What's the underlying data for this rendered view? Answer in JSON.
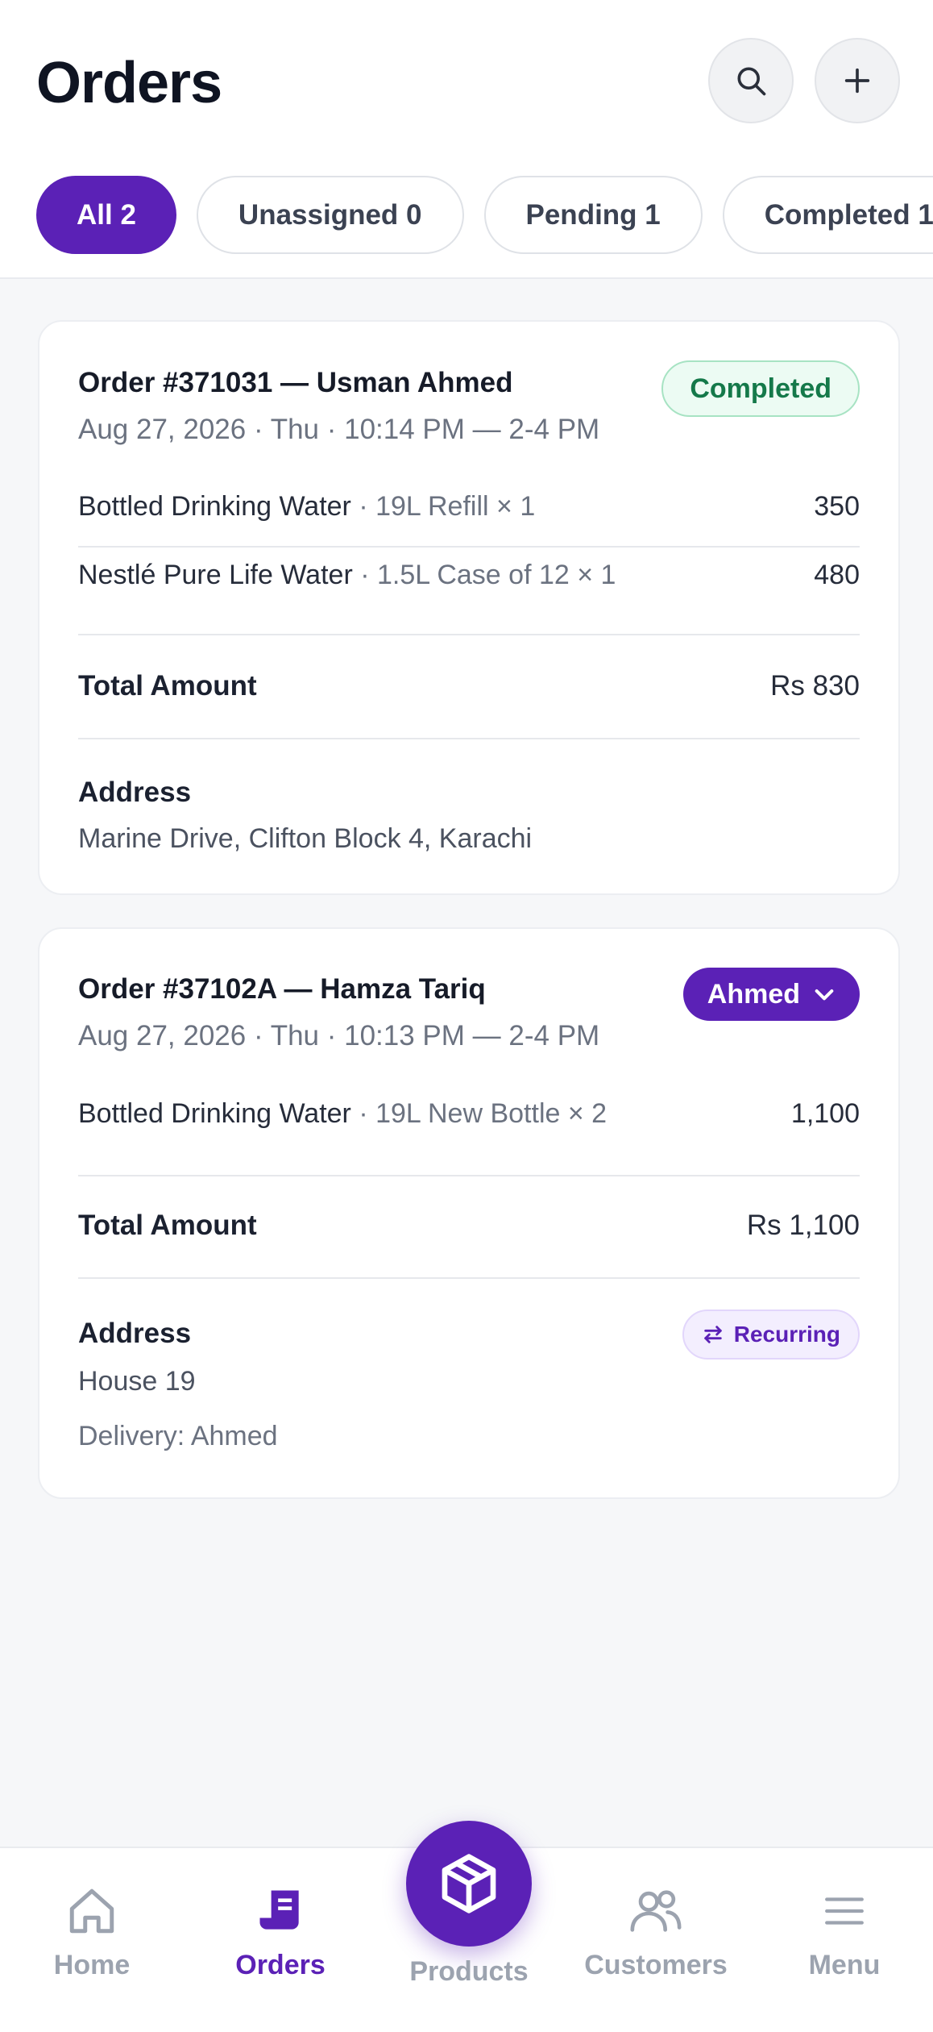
{
  "header": {
    "title": "Orders",
    "search_icon": "search-icon",
    "add_icon": "plus-icon"
  },
  "tabs": [
    {
      "label": "All 2",
      "active": true
    },
    {
      "label": "Unassigned 0",
      "active": false
    },
    {
      "label": "Pending 1",
      "active": false
    },
    {
      "label": "Completed 1",
      "active": false
    }
  ],
  "orders": [
    {
      "title": "Order #371031 — Usman Ahmed",
      "date": "Aug 27, 2026 · Thu · 10:14 PM — 2-4 PM",
      "status": "Completed",
      "items": [
        {
          "name": "Bottled Drinking Water",
          "meta": " · 19L Refill × 1",
          "price": "350"
        },
        {
          "name": "Nestlé Pure Life Water",
          "meta": " · 1.5L Case of 12 × 1",
          "price": "480"
        }
      ],
      "total_label": "Total Amount",
      "total_value": "Rs 830",
      "address_label": "Address",
      "address": "Marine Drive, Clifton Block 4, Karachi"
    },
    {
      "title": "Order #37102A — Hamza Tariq",
      "date": "Aug 27, 2026 · Thu · 10:13 PM — 2-4 PM",
      "assignee": "Ahmed",
      "items": [
        {
          "name": "Bottled Drinking Water",
          "meta": " · 19L New Bottle × 2",
          "price": "1,100"
        }
      ],
      "total_label": "Total Amount",
      "total_value": "Rs 1,100",
      "address_label": "Address",
      "address": "House 19",
      "delivery": "Delivery: Ahmed",
      "recurring_label": "Recurring"
    }
  ],
  "nav": {
    "home": "Home",
    "orders": "Orders",
    "products": "Products",
    "customers": "Customers",
    "menu": "Menu",
    "active": "orders"
  },
  "colors": {
    "accent": "#5b21b6",
    "completed_text": "#15794a",
    "completed_bg": "#ecfbf3"
  }
}
